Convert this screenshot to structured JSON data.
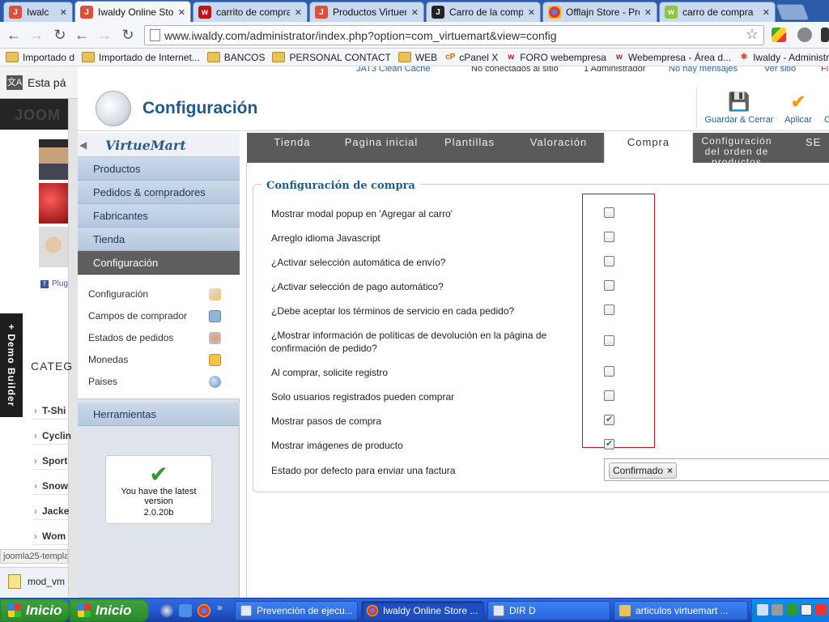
{
  "browser": {
    "tabs": [
      {
        "title": "Iwalc",
        "icon": "joomla-icon",
        "color": "#e04e39"
      },
      {
        "title": "Iwaldy Online Store",
        "icon": "joomla-icon",
        "color": "#e04e39",
        "active": true
      },
      {
        "title": "carrito de compra y",
        "icon": "webempresa-icon",
        "color": "#c0141b"
      },
      {
        "title": "Productos Virtuema",
        "icon": "joomla-icon",
        "color": "#e04e39"
      },
      {
        "title": "Carro de la compra",
        "icon": "joomla-icon",
        "color": "#222222"
      },
      {
        "title": "Offlajn Store - Pro",
        "icon": "chrome-icon",
        "color": "#e33"
      },
      {
        "title": "carro de compra",
        "icon": "webempresa-icon",
        "color": "#8cc63f"
      }
    ],
    "url": "www.iwaldy.com/administrator/index.php?option=com_virtuemart&view=config",
    "bookmarks": [
      {
        "label": "Importado d",
        "type": "folder"
      },
      {
        "label": "Importado de Internet...",
        "type": "folder"
      },
      {
        "label": "BANCOS",
        "type": "folder"
      },
      {
        "label": "PERSONAL CONTACT",
        "type": "folder"
      },
      {
        "label": "WEB",
        "type": "folder"
      },
      {
        "label": "cPanel X",
        "type": "cpanel"
      },
      {
        "label": "FORO webempresa",
        "type": "web"
      },
      {
        "label": "Webempresa - Área d...",
        "type": "web"
      },
      {
        "label": "Iwaldy - Administración",
        "type": "joomla"
      }
    ]
  },
  "underlying_page": {
    "translate_text": "Esta pá",
    "facebook_plugin": "Plug",
    "demo_builder": "+ Demo Builder",
    "categ_title": "CATEG",
    "categories": [
      "T-Shi",
      "Cyclin",
      "Sport",
      "Snow",
      "Jacke",
      "Wom"
    ],
    "status_tip": "joomla25-templat",
    "download_file": "mod_vm"
  },
  "admin": {
    "top_links": [
      "JAT3 Clean Cache",
      "No conectados al sitio",
      "1 Administrador",
      "No hay mensajes",
      "Ver sitio",
      "Fi"
    ],
    "page_title": "Configuración",
    "toolbar": {
      "save_close": "Guardar & Cerrar",
      "apply": "Aplicar",
      "cancel": "C"
    },
    "logo_text": "VirtueMart",
    "menu": {
      "sections": [
        "Productos",
        "Pedidos & compradores",
        "Fabricantes",
        "Tienda",
        "Configuración"
      ],
      "submenu": [
        "Configuración",
        "Campos de comprador",
        "Estados de pedidos",
        "Monedas",
        "Paises"
      ],
      "tools": "Herramientas"
    },
    "version_box": {
      "line1": "You have the latest",
      "line2": "version",
      "version": "2.0.20b"
    },
    "tabs": [
      {
        "label": "Tienda"
      },
      {
        "label": "Pagina inicial"
      },
      {
        "label": "Plantillas"
      },
      {
        "label": "Valoración"
      },
      {
        "label": "Compra",
        "active": true
      },
      {
        "label": "Configuración del orden de productos"
      },
      {
        "label": "SE"
      }
    ],
    "section_title": "Configuración de compra",
    "options": [
      {
        "label": "Mostrar modal popup en 'Agregar al carro'",
        "checked": false
      },
      {
        "label": "Arreglo idioma Javascript",
        "checked": false
      },
      {
        "label": "¿Activar selección automática de envío?",
        "checked": false
      },
      {
        "label": "¿Activar selección de pago automático?",
        "checked": false
      },
      {
        "label": "¿Debe aceptar los términos de servicio en cada pedido?",
        "checked": false
      },
      {
        "label": "¿Mostrar información de políticas de devolución en la página de confirmación de pedido?",
        "checked": false
      },
      {
        "label": "Al comprar, solicite registro",
        "checked": false
      },
      {
        "label": "Solo usuarios registrados pueden comprar",
        "checked": false
      },
      {
        "label": "Mostrar pasos de compra",
        "checked": true
      },
      {
        "label": "Mostrar imágenes de producto",
        "checked": true
      }
    ],
    "invoice_label": "Estado por defecto para enviar una factura",
    "invoice_value": "Confirmado",
    "invoice_remove": "×"
  },
  "taskbar": {
    "start1": "Inicio",
    "start2": "Inicio",
    "quicklaunch_more": "»",
    "tasks": [
      {
        "label": "Prevención de ejecu...",
        "icon": "window-icon"
      },
      {
        "label": "Iwaldy Online Store ...",
        "icon": "chrome-icon",
        "active": true
      },
      {
        "label": "DIR D",
        "icon": "window-icon"
      },
      {
        "label": "articulos virtuemart ...",
        "icon": "folder-icon"
      }
    ]
  }
}
